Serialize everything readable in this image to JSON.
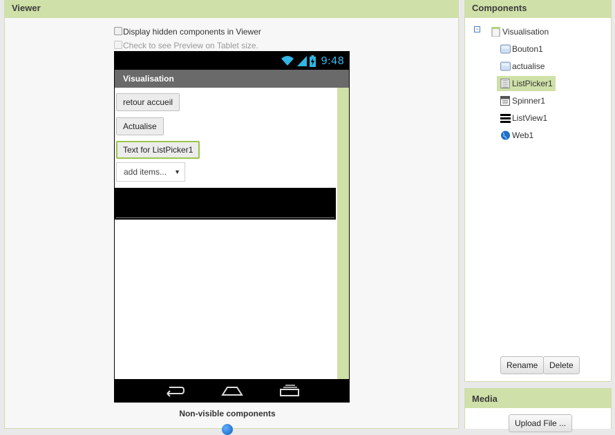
{
  "viewer": {
    "title": "Viewer",
    "display_hidden_label": "Display hidden components in Viewer",
    "tablet_preview_label": "Check to see Preview on Tablet size.",
    "phone": {
      "time": "9:48",
      "screen_title": "Visualisation",
      "buttons": [
        "retour accueil",
        "Actualise",
        "Text for ListPicker1"
      ],
      "spinner_text": "add items...",
      "spinner_arrow": "▼"
    },
    "non_visible_label": "Non-visible components"
  },
  "components": {
    "title": "Components",
    "collapse_symbol": "−",
    "tree": [
      {
        "label": "Visualisation",
        "icon": "screen-icon"
      },
      {
        "label": "Bouton1",
        "icon": "button-icon"
      },
      {
        "label": "actualise",
        "icon": "button-icon"
      },
      {
        "label": "ListPicker1",
        "icon": "listpicker-icon",
        "selected": true
      },
      {
        "label": "Spinner1",
        "icon": "spinner-icon"
      },
      {
        "label": "ListView1",
        "icon": "listview-icon"
      },
      {
        "label": "Web1",
        "icon": "web-globe-icon"
      }
    ],
    "rename_label": "Rename",
    "delete_label": "Delete"
  },
  "media": {
    "title": "Media",
    "upload_label": "Upload File ..."
  },
  "colors": {
    "panel_header": "#cfe0a8",
    "selection_border": "#9bc44a",
    "status_time": "#33b5e5"
  }
}
